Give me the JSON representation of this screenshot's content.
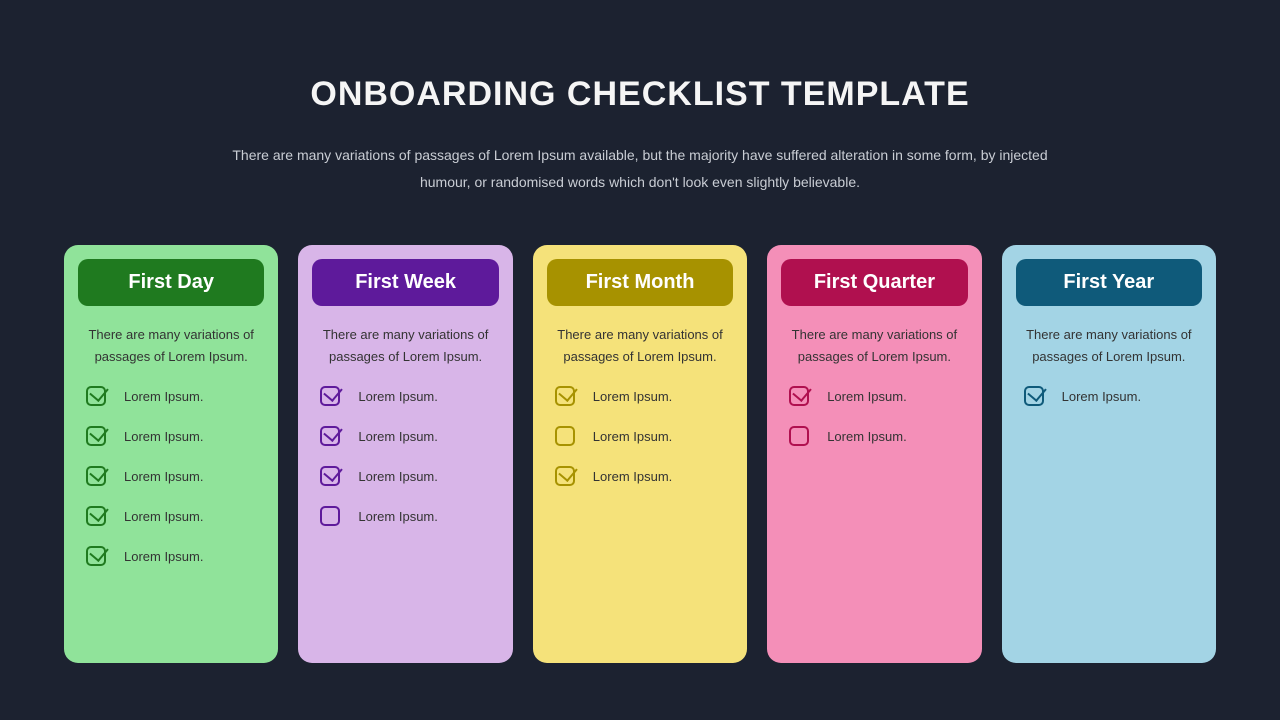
{
  "title": "ONBOARDING CHECKLIST TEMPLATE",
  "subtitle": "There are many variations of passages of Lorem Ipsum available, but the majority have suffered alteration in some form, by injected humour, or randomised words which don't look even slightly believable.",
  "cards": [
    {
      "title": "First Day",
      "desc": "There are many variations of passages of Lorem Ipsum.",
      "items": [
        {
          "label": "Lorem Ipsum.",
          "checked": true
        },
        {
          "label": "Lorem Ipsum.",
          "checked": true
        },
        {
          "label": "Lorem Ipsum.",
          "checked": true
        },
        {
          "label": "Lorem Ipsum.",
          "checked": true
        },
        {
          "label": "Lorem Ipsum.",
          "checked": true
        }
      ]
    },
    {
      "title": "First Week",
      "desc": "There are many variations of passages of Lorem Ipsum.",
      "items": [
        {
          "label": "Lorem Ipsum.",
          "checked": true
        },
        {
          "label": "Lorem Ipsum.",
          "checked": true
        },
        {
          "label": "Lorem Ipsum.",
          "checked": true
        },
        {
          "label": "Lorem Ipsum.",
          "checked": false
        }
      ]
    },
    {
      "title": "First Month",
      "desc": "There are many variations of passages of Lorem Ipsum.",
      "items": [
        {
          "label": "Lorem Ipsum.",
          "checked": true
        },
        {
          "label": "Lorem Ipsum.",
          "checked": false
        },
        {
          "label": "Lorem Ipsum.",
          "checked": true
        }
      ]
    },
    {
      "title": "First Quarter",
      "desc": "There are many variations of passages of Lorem Ipsum.",
      "items": [
        {
          "label": "Lorem Ipsum.",
          "checked": true
        },
        {
          "label": "Lorem Ipsum.",
          "checked": false
        }
      ]
    },
    {
      "title": "First Year",
      "desc": "There are many variations of passages of Lorem Ipsum.",
      "items": [
        {
          "label": "Lorem Ipsum.",
          "checked": true
        }
      ]
    }
  ]
}
